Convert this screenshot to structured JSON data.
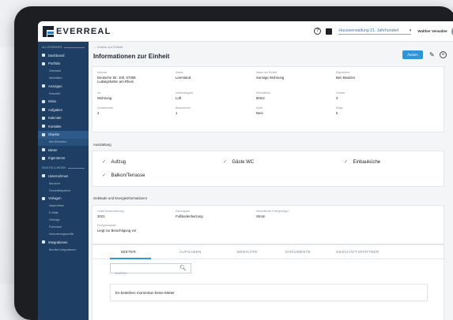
{
  "brand": {
    "name": "EVERREAL"
  },
  "topbar": {
    "portfolio": "Hauswerwaltung 21. Jahrhundert",
    "caret": "▾",
    "user_name": "Walther Verwalter",
    "avatar_initials": "WV",
    "help_glyph": "?",
    "settings_glyph": "⚙",
    "edit_glyph": "✎"
  },
  "sidebar": {
    "section_general": "ALLGEMEINES",
    "items_top": [
      {
        "label": "Dashboard",
        "icon": "dashboard-icon"
      },
      {
        "label": "Portfolio",
        "icon": "portfolio-icon"
      }
    ],
    "portfolio_sub": [
      "Übersicht",
      "Aktivitäten"
    ],
    "item_anzeigen": "Anzeigen",
    "anzeigen_sub": [
      "Entwürfe"
    ],
    "items_mid": [
      {
        "label": "Inbox",
        "icon": "inbox-icon"
      },
      {
        "label": "Aufgaben",
        "icon": "tasks-icon"
      },
      {
        "label": "Kalender",
        "icon": "calendar-icon"
      },
      {
        "label": "Kontakte",
        "icon": "contacts-icon"
      },
      {
        "label": "Objekte",
        "icon": "objects-icon"
      }
    ],
    "objekte_sub": [
      "Alle Einheiten"
    ],
    "items_low": [
      {
        "label": "Mieter",
        "icon": "tenant-icon"
      },
      {
        "label": "Eigentümer",
        "icon": "owner-icon"
      }
    ],
    "section_settings": "EINSTELLUNGEN",
    "item_unternehmen": "Unternehmen",
    "unternehmen_sub": [
      "Benutzer",
      "Geschäftspartner"
    ],
    "item_vorlagen": "Vorlagen",
    "vorlagen_sub": [
      "Nachrichten",
      "E-Mails",
      "Verträge",
      "Formulare",
      "Anforderungsprofile"
    ],
    "item_integrationen": "Integrationen",
    "integrationen_sub": [
      "Bereitet Integrationen"
    ]
  },
  "main": {
    "breadcrumb": "← Zurück zur Einheit",
    "title": "Informationen zur Einheit",
    "update_button": "Ändern"
  },
  "info": {
    "fields": [
      {
        "label": "Adresse",
        "value": "Deutsche Str. 100, 67059 Ludwigshafen am Rhein"
      },
      {
        "label": "Status",
        "value": "Leerstand"
      },
      {
        "label": "Name der Einheit",
        "value": "Sonnige Wohnung"
      },
      {
        "label": "Eigentümer",
        "value": "Ben Besitzer"
      },
      {
        "label": "Art",
        "value": "Wohnung"
      },
      {
        "label": "Unterkategorie",
        "value": "Loft"
      },
      {
        "label": "Wohnfläche",
        "value": "80m2"
      },
      {
        "label": "Zimmer",
        "value": "3"
      },
      {
        "label": "Schlafzimmer",
        "value": "2"
      },
      {
        "label": "Badezimmer",
        "value": "1"
      },
      {
        "label": "Keller",
        "value": "Nein"
      },
      {
        "label": "Etage",
        "value": "5"
      }
    ]
  },
  "amenities": {
    "title": "Ausstattung",
    "items": [
      "Aufzug",
      "Gäste WC",
      "Einbauküche",
      "Balkon/Terrasse"
    ],
    "check_glyph": "✓"
  },
  "building": {
    "title": "Gebäude und Energieinformationen",
    "fields": [
      {
        "label": "Letzte Modernisierung",
        "value": "2021"
      },
      {
        "label": "Heizungsart",
        "value": "Fußbodenheizung"
      },
      {
        "label": "Wesentlicher Energieträger",
        "value": "Strom"
      },
      {
        "label": "Energieausweis",
        "value": "Liegt zur Besichtigung vor"
      }
    ]
  },
  "tabs": {
    "items": [
      "MIETER",
      "AUFGABEN",
      "BERICHTE",
      "DOKUMENTE",
      "GESCHÄFTSPARTNER"
    ],
    "search_placeholder": "Suchen",
    "search_glyph": "🔍︎",
    "empty_text": "Es bestehen momentan keine Mieter"
  }
}
